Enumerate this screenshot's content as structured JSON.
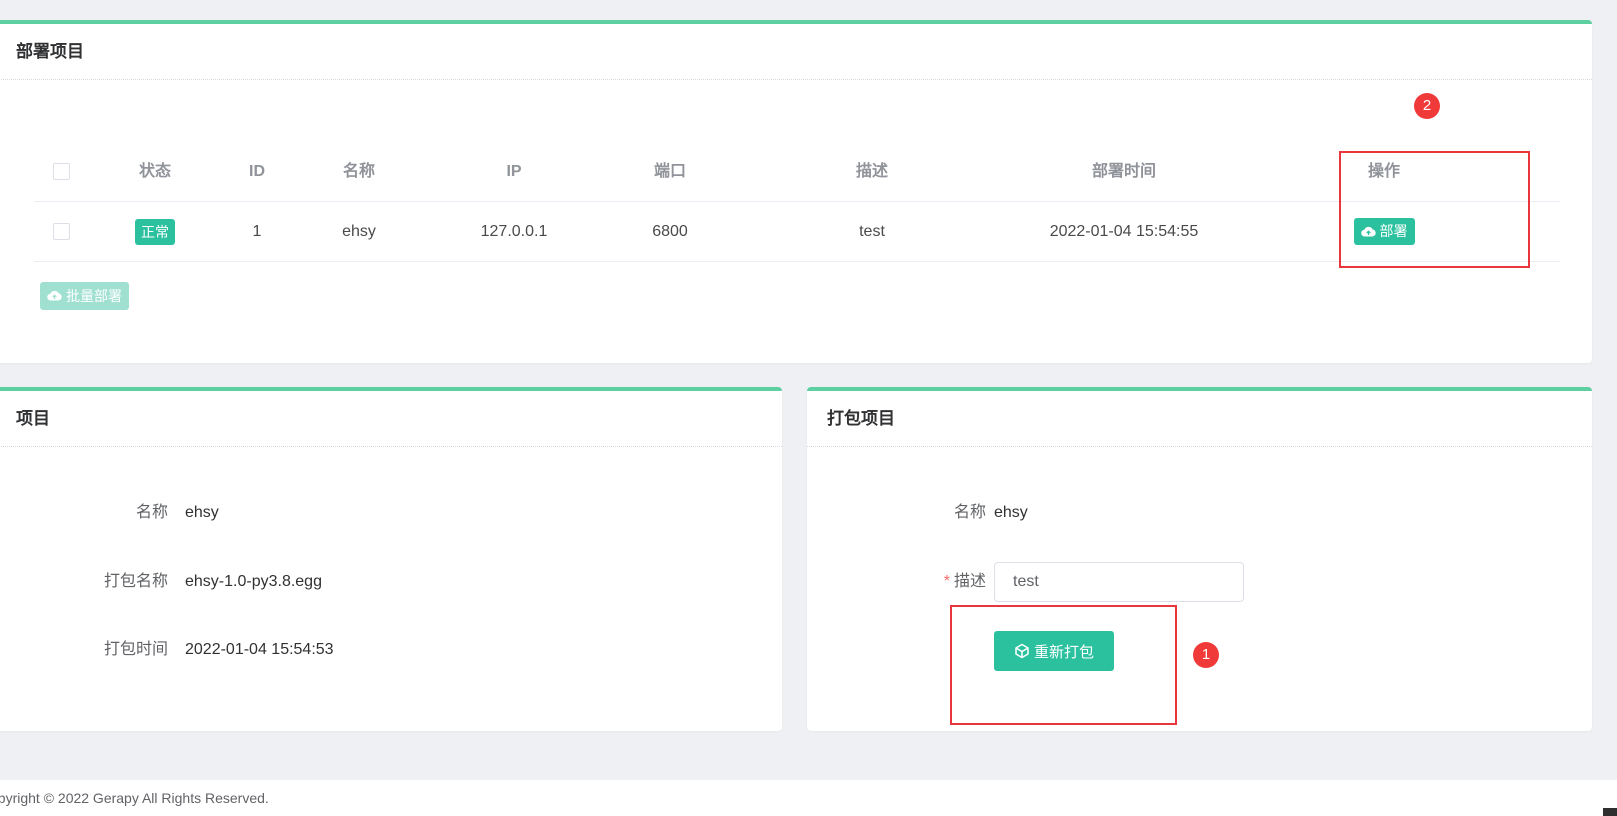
{
  "deploy_card": {
    "title": "部署项目",
    "columns": [
      "状态",
      "ID",
      "名称",
      "IP",
      "端口",
      "描述",
      "部署时间",
      "操作"
    ],
    "rows": [
      {
        "status": "正常",
        "id": "1",
        "name": "ehsy",
        "ip": "127.0.0.1",
        "port": "6800",
        "description": "test",
        "deploy_time": "2022-01-04 15:54:55",
        "action_label": "部署"
      }
    ],
    "batch_deploy_label": "批量部署",
    "annotation_number": "2"
  },
  "project_card": {
    "title": "项目",
    "fields": [
      {
        "label": "名称",
        "value": "ehsy"
      },
      {
        "label": "打包名称",
        "value": "ehsy-1.0-py3.8.egg"
      },
      {
        "label": "打包时间",
        "value": "2022-01-04 15:54:53"
      }
    ]
  },
  "package_card": {
    "title": "打包项目",
    "name_label": "名称",
    "name_value": "ehsy",
    "required_mark": "*",
    "desc_label": "描述",
    "desc_value": "test",
    "repack_label": "重新打包",
    "annotation_number": "1"
  },
  "footer": {
    "copyright": "opyright © 2022 Gerapy All Rights Reserved."
  },
  "colors": {
    "accent": "#2bc19f",
    "card_top_border": "#5ecfa1",
    "annotation_red": "#e8363c",
    "background": "#eef0f3"
  }
}
